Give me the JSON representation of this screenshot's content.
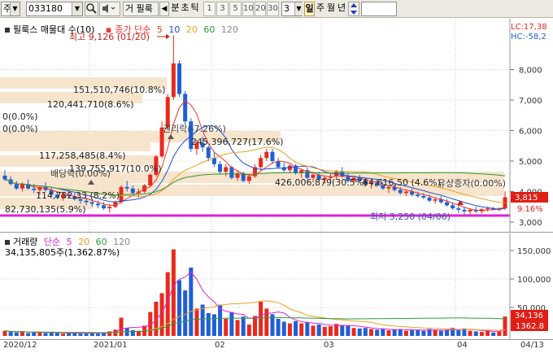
{
  "toolbar": {
    "market": "주",
    "code": "033180",
    "company": "필룩",
    "company_prefix": "거",
    "period_prev": "◀",
    "period_tabs": [
      "분",
      "초",
      "틱",
      "1",
      "3",
      "5",
      "10",
      "20",
      "30"
    ],
    "count": "3",
    "tabs_right": [
      "일",
      "주",
      "월",
      "년"
    ]
  },
  "price_chart": {
    "title": "필룩스 매물대 수(10)",
    "ma_label": "종가 단순",
    "ma_periods": [
      "5",
      "10",
      "20",
      "60",
      "120"
    ],
    "ma_colors": [
      "#e8392e",
      "#1d4fd8",
      "#f0a020",
      "#2e9a3c",
      "#8a8a8a"
    ],
    "corner_lc": "LC:17,38",
    "corner_hc": "HC:-58,2",
    "y_ticks": [
      "8,000",
      "7,000",
      "6,000",
      "5,000",
      "4,000",
      "3,000"
    ],
    "high_label": "최고 9,126 (01/20)",
    "low_label": "최저 3,250 (04/06)",
    "current_price": "3,815",
    "current_pct": "9.16%",
    "annotations": [
      "권리락(-7.26%)",
      "배당락(0.00%)",
      "유상증자(0.00%)"
    ],
    "volume_profile": [
      "151,510,746(10.8%)",
      "120,441,710(8.6%)",
      "0(0.0%)",
      "0(0.0%)",
      "117,258,485(8.4%)",
      "139,755,917(10.0%)",
      "114,752,33 (8.2%)",
      "82,730,135(5.9%)",
      "245,396,727(17.6%)",
      "426,006,879(30.5%)",
      "64,616,50 (4.6%)"
    ],
    "colors": {
      "up": "#e8291c",
      "down": "#1f5fd6",
      "profile": "#f6e4cc",
      "low_line": "#e020d8"
    }
  },
  "volume_chart": {
    "title": "거래량",
    "ma_label": "단순",
    "ma_periods": [
      "5",
      "20",
      "60",
      "120"
    ],
    "ma_colors": [
      "#e020d8",
      "#f0a020",
      "#2e9a3c",
      "#8a8a8a"
    ],
    "stat": "34,135,805주(1,362.87%)",
    "y_ticks": [
      "150,000",
      "100,000",
      "50,000"
    ],
    "current_value": "34,136",
    "current_pct": "1362.8"
  },
  "date_axis": [
    "2020/12",
    "2021/01",
    "02",
    "03",
    "04",
    "04/13"
  ]
}
